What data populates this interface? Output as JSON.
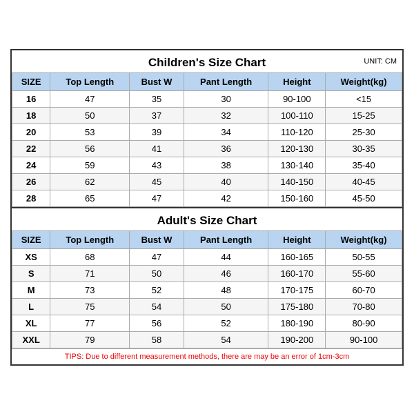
{
  "children_title": "Children's Size Chart",
  "adults_title": "Adult's Size Chart",
  "unit": "UNIT: CM",
  "headers": [
    "SIZE",
    "Top Length",
    "Bust W",
    "Pant Length",
    "Height",
    "Weight(kg)"
  ],
  "children_rows": [
    [
      "16",
      "47",
      "35",
      "30",
      "90-100",
      "<15"
    ],
    [
      "18",
      "50",
      "37",
      "32",
      "100-110",
      "15-25"
    ],
    [
      "20",
      "53",
      "39",
      "34",
      "110-120",
      "25-30"
    ],
    [
      "22",
      "56",
      "41",
      "36",
      "120-130",
      "30-35"
    ],
    [
      "24",
      "59",
      "43",
      "38",
      "130-140",
      "35-40"
    ],
    [
      "26",
      "62",
      "45",
      "40",
      "140-150",
      "40-45"
    ],
    [
      "28",
      "65",
      "47",
      "42",
      "150-160",
      "45-50"
    ]
  ],
  "adult_rows": [
    [
      "XS",
      "68",
      "47",
      "44",
      "160-165",
      "50-55"
    ],
    [
      "S",
      "71",
      "50",
      "46",
      "160-170",
      "55-60"
    ],
    [
      "M",
      "73",
      "52",
      "48",
      "170-175",
      "60-70"
    ],
    [
      "L",
      "75",
      "54",
      "50",
      "175-180",
      "70-80"
    ],
    [
      "XL",
      "77",
      "56",
      "52",
      "180-190",
      "80-90"
    ],
    [
      "XXL",
      "79",
      "58",
      "54",
      "190-200",
      "90-100"
    ]
  ],
  "tips": "TIPS: Due to different measurement methods, there are may be an error of 1cm-3cm"
}
